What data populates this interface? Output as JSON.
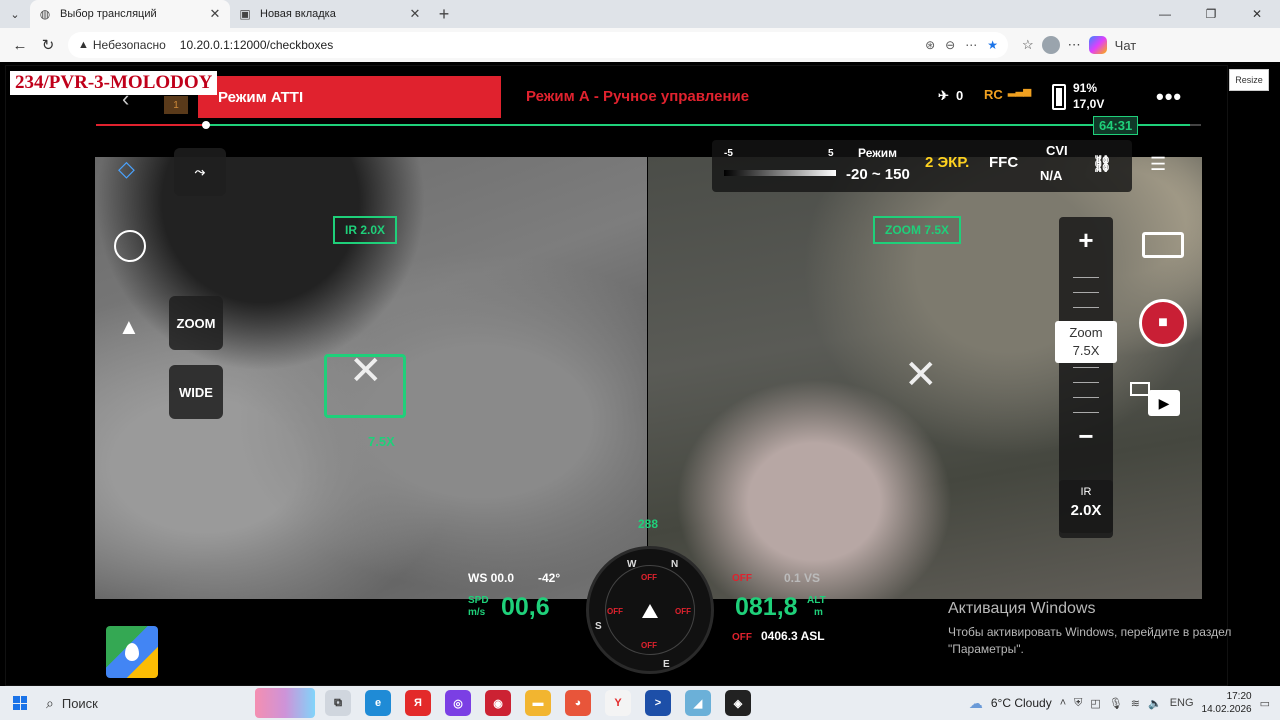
{
  "browser": {
    "tabs": [
      {
        "label": "Выбор трансляций",
        "icon": "globe-icon"
      },
      {
        "label": "Новая вкладка",
        "icon": "page-icon"
      }
    ],
    "address": {
      "security": "Небезопасно",
      "url": "10.20.0.1:12000/checkboxes"
    },
    "copilot_label": "Чат"
  },
  "stream": {
    "channel": "234/PVR-3-MOLODOY",
    "resize_label": "Resize",
    "hud_top": {
      "mode_atti": "Режим ATTI",
      "mode_a": "Режим А - Ручное управление",
      "small_box": "1",
      "gps_count": "0",
      "rc_label": "RC",
      "battery_pct": "91%",
      "battery_volt": "17,0V",
      "elapsed": "64:31",
      "progress_fraction": 0.99
    },
    "ir_feed": {
      "tag": "IR  2.0X",
      "reticle_zoom": "7.5X",
      "zoom_btn": "ZOOM",
      "wide_btn": "WIDE"
    },
    "zoom_feed": {
      "tag": "ZOOM  7.5X",
      "thermal": {
        "range_min": "-5",
        "range_max": "5",
        "mode_label": "Режим",
        "mode_value": "-20 ~ 150",
        "screens": "2 ЭКР.",
        "ffc": "FFC",
        "cvi": "CVI",
        "na": "N/A"
      },
      "zoom_label": "Zoom",
      "zoom_value": "7.5X",
      "ir_label": "IR",
      "ir_value": "2.0X"
    },
    "hud_bottom": {
      "heading": "288",
      "ws": "WS 00.0",
      "ws_dir": "-42°",
      "spd_unit1": "SPD",
      "spd_unit2": "m/s",
      "spd_value": "00,6",
      "alt_value": "081,8",
      "alt_unit1": "ALT",
      "alt_unit2": "m",
      "vs_off": "OFF",
      "vs_value": "0.1  VS",
      "asl_off": "OFF",
      "asl_value": "0406.3 ASL",
      "compass_n": "N",
      "compass_w": "W",
      "compass_s": "S",
      "compass_e": "E",
      "off": "OFF"
    }
  },
  "activation": {
    "title": "Активация Windows",
    "text": "Чтобы активировать Windows, перейдите в раздел \"Параметры\"."
  },
  "taskbar": {
    "search": "Поиск",
    "weather": "6°C  Cloudy",
    "lang": "ENG",
    "time": "17:20",
    "date": "14.02.2026"
  }
}
